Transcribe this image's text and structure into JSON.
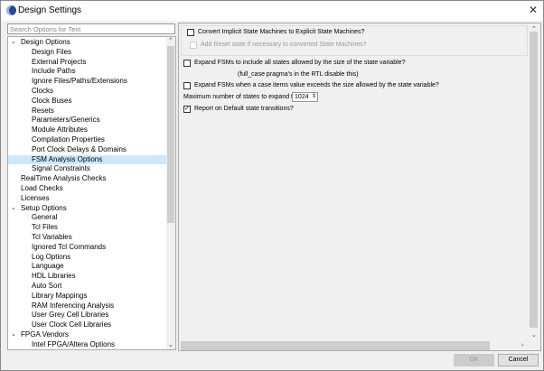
{
  "window": {
    "title": "Design Settings",
    "close_icon": "close-icon"
  },
  "search": {
    "placeholder": "Search Options for Text"
  },
  "tree": [
    {
      "label": "Design Options",
      "level": 0,
      "expanded": true
    },
    {
      "label": "Design Files",
      "level": 1
    },
    {
      "label": "External Projects",
      "level": 1
    },
    {
      "label": "Include Paths",
      "level": 1
    },
    {
      "label": "Ignore Files/Paths/Extensions",
      "level": 1
    },
    {
      "label": "Clocks",
      "level": 1
    },
    {
      "label": "Clock Buses",
      "level": 1
    },
    {
      "label": "Resets",
      "level": 1
    },
    {
      "label": "Parameters/Generics",
      "level": 1
    },
    {
      "label": "Module Attributes",
      "level": 1
    },
    {
      "label": "Compilation Properties",
      "level": 1
    },
    {
      "label": "Port Clock Delays & Domains",
      "level": 1
    },
    {
      "label": "FSM Analysis Options",
      "level": 1,
      "selected": true
    },
    {
      "label": "Signal Constraints",
      "level": 1
    },
    {
      "label": "RealTime Analysis Checks",
      "level": 0
    },
    {
      "label": "Load Checks",
      "level": 0
    },
    {
      "label": "Licenses",
      "level": 0
    },
    {
      "label": "Setup Options",
      "level": 0,
      "expanded": true
    },
    {
      "label": "General",
      "level": 1
    },
    {
      "label": "Tcl Files",
      "level": 1
    },
    {
      "label": "Tcl Variables",
      "level": 1
    },
    {
      "label": "Ignored Tcl Commands",
      "level": 1
    },
    {
      "label": "Log Options",
      "level": 1
    },
    {
      "label": "Language",
      "level": 1
    },
    {
      "label": "HDL Libraries",
      "level": 1
    },
    {
      "label": "Auto Sort",
      "level": 1
    },
    {
      "label": "Library Mappings",
      "level": 1
    },
    {
      "label": "RAM Inferencing Analysis",
      "level": 1
    },
    {
      "label": "User Grey Cell Libraries",
      "level": 1
    },
    {
      "label": "User Clock Cell Libraries",
      "level": 1
    },
    {
      "label": "FPGA Vendors",
      "level": 0,
      "expanded": true
    },
    {
      "label": "Intel FPGA/Altera Options",
      "level": 1
    }
  ],
  "options": {
    "convert": {
      "label": "Convert Implicit State Machines to Explicit State Machines?",
      "checked": false
    },
    "add_reset": {
      "label": "Add Reset state if necessary to converted State Machines?",
      "checked": false,
      "disabled": true
    },
    "expand_all": {
      "label": "Expand FSMs to include all states allowed by the size of the state variable?",
      "checked": false
    },
    "expand_note": "(full_case pragma's in the RTL disable this)",
    "expand_exceed": {
      "label": "Expand FSMs when a case items value exceeds the size allowed by the state variable?",
      "checked": false
    },
    "max_states": {
      "label": "Maximum number of states to expand to?",
      "value": "1024"
    },
    "report_default": {
      "label": "Report on Default state transitions?",
      "checked": true
    }
  },
  "buttons": {
    "ok": "OK",
    "cancel": "Cancel"
  }
}
